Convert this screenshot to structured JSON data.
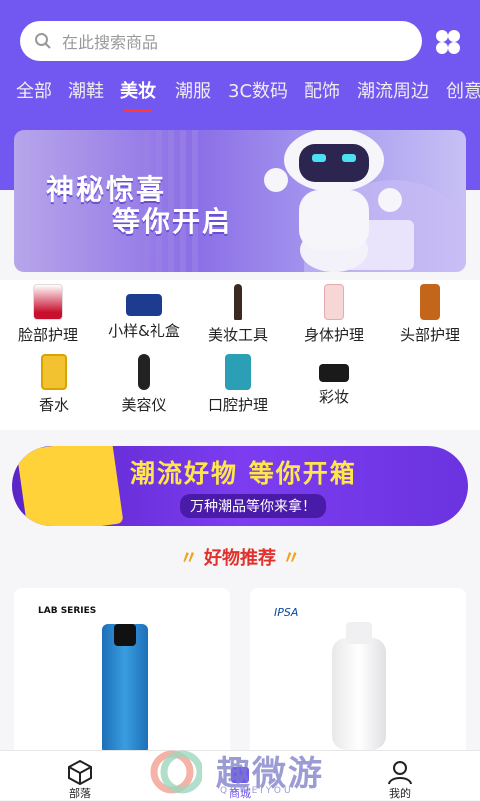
{
  "search": {
    "placeholder": "在此搜索商品"
  },
  "tabs": [
    "全部",
    "潮鞋",
    "美妆",
    "潮服",
    "3C数码",
    "配饰",
    "潮流周边",
    "创意"
  ],
  "active_tab_index": 2,
  "banner": {
    "line1": "神秘惊喜",
    "line2": "等你开启"
  },
  "categories": [
    {
      "label": "脸部护理"
    },
    {
      "label": "小样&礼盒"
    },
    {
      "label": "美妆工具"
    },
    {
      "label": "身体护理"
    },
    {
      "label": "头部护理"
    },
    {
      "label": "香水"
    },
    {
      "label": "美容仪"
    },
    {
      "label": "口腔护理"
    },
    {
      "label": "彩妆"
    }
  ],
  "promo": {
    "title": "潮流好物 等你开箱",
    "subtitle": "万种潮品等你来拿！"
  },
  "section_title": "好物推荐",
  "products": [
    {
      "brand": "LAB SERIES"
    },
    {
      "brand": "IPSA"
    }
  ],
  "tabbar": [
    {
      "label": "部落"
    },
    {
      "label": "商城"
    },
    {
      "label": "我的"
    }
  ],
  "watermark": {
    "text": "趣微游",
    "sub": "QUWEIYOU"
  },
  "colors": {
    "header": "#7257f0",
    "accent": "#ff3b30",
    "section_title": "#e0312d"
  }
}
